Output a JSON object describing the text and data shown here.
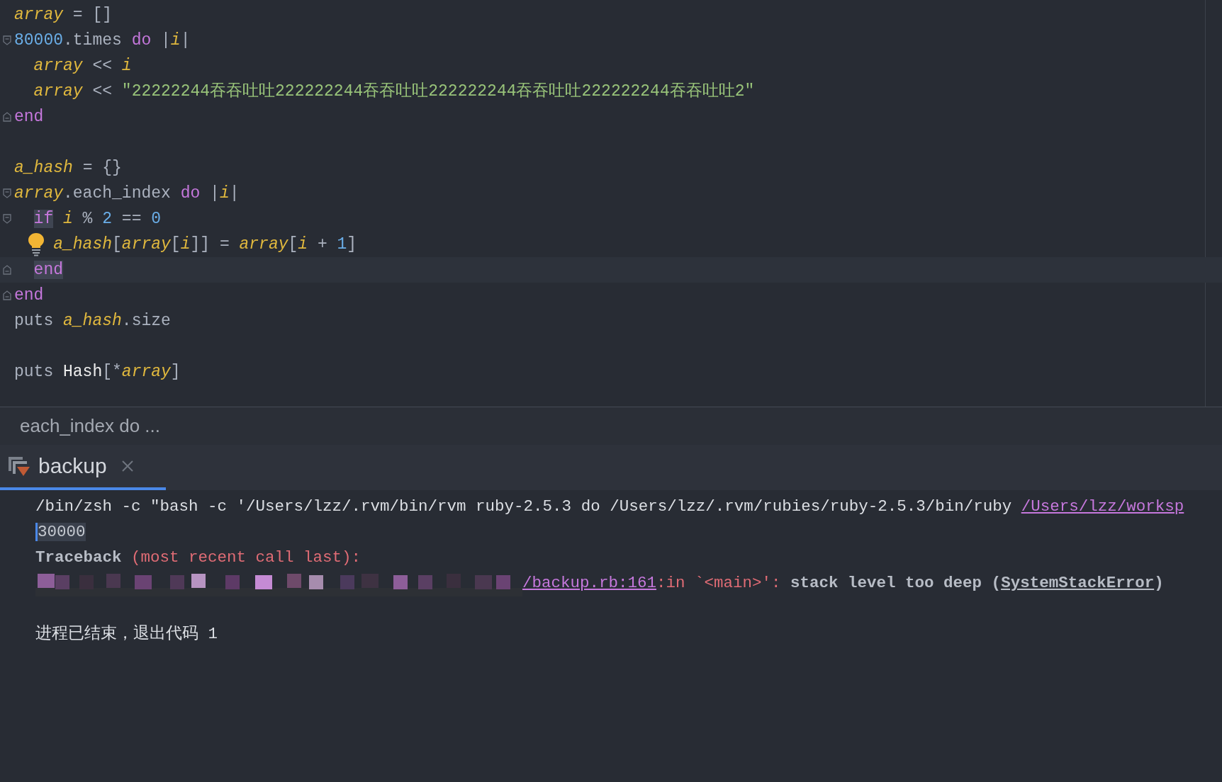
{
  "editor": {
    "lines": [
      {
        "kind": "code",
        "fold_start": false,
        "fold_end": false,
        "bulb": false,
        "current": false,
        "tokens": [
          {
            "kind": "var",
            "text": "array"
          },
          {
            "kind": "plain",
            "text": " = []"
          }
        ]
      },
      {
        "kind": "code",
        "fold_start": true,
        "fold_end": false,
        "bulb": false,
        "current": false,
        "tokens": [
          {
            "kind": "num",
            "text": "80000"
          },
          {
            "kind": "plain",
            "text": ".times "
          },
          {
            "kind": "kw",
            "text": "do"
          },
          {
            "kind": "plain",
            "text": " |"
          },
          {
            "kind": "var",
            "text": "i"
          },
          {
            "kind": "plain",
            "text": "|"
          }
        ],
        "children": [
          {
            "kind": "code",
            "fold_start": false,
            "fold_end": false,
            "bulb": false,
            "current": false,
            "tokens": [
              {
                "kind": "var",
                "text": "array"
              },
              {
                "kind": "plain",
                "text": " << "
              },
              {
                "kind": "var",
                "text": "i"
              }
            ]
          },
          {
            "kind": "code",
            "fold_start": false,
            "fold_end": false,
            "bulb": false,
            "current": false,
            "tokens": [
              {
                "kind": "var",
                "text": "array"
              },
              {
                "kind": "plain",
                "text": " << "
              },
              {
                "kind": "str",
                "text": "\"22222244吞吞吐吐222222244吞吞吐吐222222244吞吞吐吐222222244吞吞吐吐2\""
              }
            ]
          }
        ]
      },
      {
        "kind": "code",
        "fold_start": false,
        "fold_end": true,
        "bulb": false,
        "current": false,
        "tokens": [
          {
            "kind": "kw",
            "text": "end"
          }
        ]
      },
      {
        "kind": "blank"
      },
      {
        "kind": "code",
        "fold_start": false,
        "fold_end": false,
        "bulb": false,
        "current": false,
        "tokens": [
          {
            "kind": "var",
            "text": "a_hash"
          },
          {
            "kind": "plain",
            "text": " = {}"
          }
        ]
      },
      {
        "kind": "code",
        "fold_start": true,
        "fold_end": false,
        "bulb": false,
        "current": false,
        "tokens": [
          {
            "kind": "var",
            "text": "array"
          },
          {
            "kind": "plain",
            "text": ".each_index "
          },
          {
            "kind": "kw",
            "text": "do"
          },
          {
            "kind": "plain",
            "text": " |"
          },
          {
            "kind": "var",
            "text": "i"
          },
          {
            "kind": "plain",
            "text": "|"
          }
        ],
        "children": [
          {
            "kind": "code",
            "fold_start": true,
            "fold_end": false,
            "bulb": false,
            "current": false,
            "tokens": [
              {
                "kind": "kw",
                "text": "if",
                "highlighted": true
              },
              {
                "kind": "var",
                "text": " i"
              },
              {
                "kind": "plain",
                "text": " % "
              },
              {
                "kind": "num",
                "text": "2"
              },
              {
                "kind": "plain",
                "text": " == "
              },
              {
                "kind": "num",
                "text": "0"
              }
            ],
            "children": [
              {
                "kind": "code",
                "fold_start": false,
                "fold_end": false,
                "bulb": true,
                "current": false,
                "tokens": [
                  {
                    "kind": "var",
                    "text": "a_hash"
                  },
                  {
                    "kind": "plain",
                    "text": "["
                  },
                  {
                    "kind": "var",
                    "text": "array"
                  },
                  {
                    "kind": "plain",
                    "text": "["
                  },
                  {
                    "kind": "var",
                    "text": "i"
                  },
                  {
                    "kind": "plain",
                    "text": "]] = "
                  },
                  {
                    "kind": "var",
                    "text": "array"
                  },
                  {
                    "kind": "plain",
                    "text": "["
                  },
                  {
                    "kind": "var",
                    "text": "i"
                  },
                  {
                    "kind": "plain",
                    "text": " + "
                  },
                  {
                    "kind": "num",
                    "text": "1"
                  },
                  {
                    "kind": "plain",
                    "text": "]"
                  }
                ]
              }
            ]
          },
          {
            "kind": "code",
            "fold_start": false,
            "fold_end": true,
            "bulb": false,
            "current": true,
            "tokens": [
              {
                "kind": "kw",
                "text": "end",
                "highlighted": true
              }
            ]
          }
        ]
      },
      {
        "kind": "code",
        "fold_start": false,
        "fold_end": true,
        "bulb": false,
        "current": false,
        "tokens": [
          {
            "kind": "kw",
            "text": "end"
          }
        ]
      },
      {
        "kind": "code",
        "fold_start": false,
        "fold_end": false,
        "bulb": false,
        "current": false,
        "tokens": [
          {
            "kind": "plain",
            "text": "puts "
          },
          {
            "kind": "var",
            "text": "a_hash"
          },
          {
            "kind": "plain",
            "text": ".size"
          }
        ]
      },
      {
        "kind": "blank"
      },
      {
        "kind": "code",
        "fold_start": false,
        "fold_end": false,
        "bulb": false,
        "current": false,
        "tokens": [
          {
            "kind": "plain",
            "text": "puts "
          },
          {
            "kind": "const",
            "text": "Hash"
          },
          {
            "kind": "plain",
            "text": "[*"
          },
          {
            "kind": "var",
            "text": "array"
          },
          {
            "kind": "plain",
            "text": "]"
          }
        ]
      }
    ]
  },
  "breadcrumb": "each_index do ...",
  "run_tab": {
    "label": "backup",
    "selected": true
  },
  "console": {
    "lines": [
      {
        "kind": "text",
        "tokens": [
          {
            "kind": "plain",
            "text": "/bin/zsh -c \"bash -c '/Users/lzz/.rvm/bin/rvm ruby-2.5.3 do /Users/lzz/.rvm/rubies/ruby-2.5.3/bin/ruby "
          },
          {
            "kind": "link",
            "text": "/Users/lzz/worksp"
          }
        ]
      },
      {
        "kind": "text",
        "tokens": [
          {
            "kind": "selected",
            "text": "30000"
          }
        ]
      },
      {
        "kind": "text",
        "tokens": [
          {
            "kind": "bold",
            "text": "Traceback"
          },
          {
            "kind": "error",
            "text": " (most recent call last):"
          }
        ]
      },
      {
        "kind": "text",
        "tokens": [
          {
            "kind": "picture"
          },
          {
            "kind": "link",
            "text": "/backup.rb:161"
          },
          {
            "kind": "error",
            "text": ":in `<main>': "
          },
          {
            "kind": "bold",
            "text": "stack level too deep ("
          },
          {
            "kind": "class_link",
            "text": "SystemStackError"
          },
          {
            "kind": "bold",
            "text": ")"
          }
        ]
      },
      {
        "kind": "blank"
      },
      {
        "kind": "text",
        "tokens": [
          {
            "kind": "plain",
            "text": "进程已结束，退出代码 1"
          }
        ]
      }
    ]
  }
}
